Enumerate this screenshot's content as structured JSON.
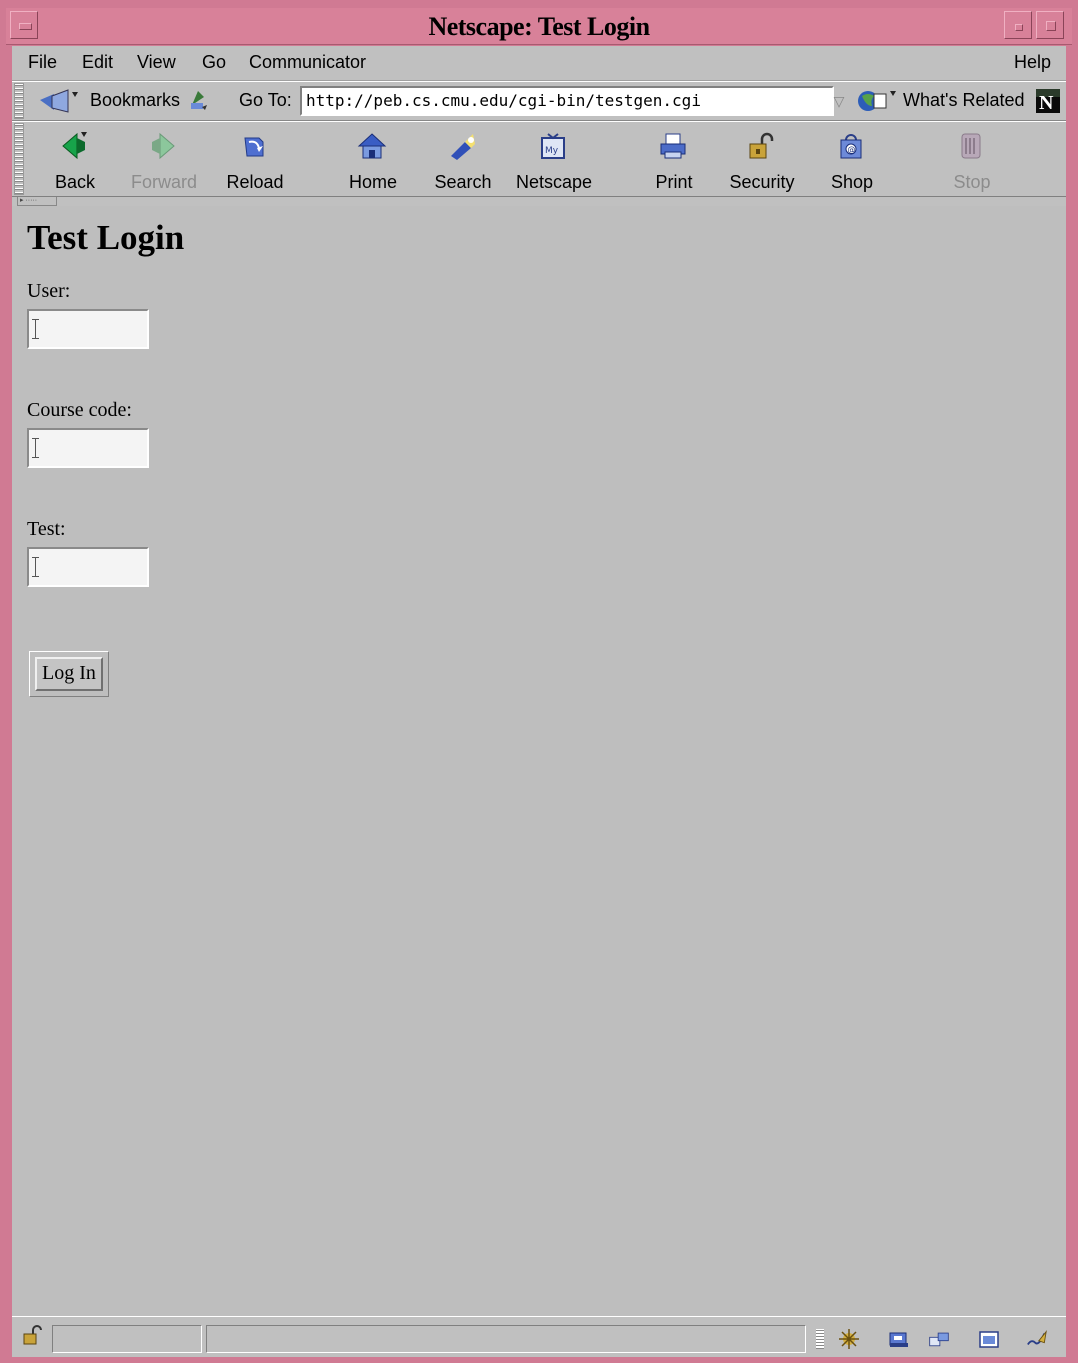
{
  "window": {
    "title": "Netscape: Test Login"
  },
  "menu": {
    "file": "File",
    "edit": "Edit",
    "view": "View",
    "go": "Go",
    "communicator": "Communicator",
    "help": "Help"
  },
  "location": {
    "bookmarks": "Bookmarks",
    "goto_label": "Go To:",
    "url": "http://peb.cs.cmu.edu/cgi-bin/testgen.cgi",
    "whats_related": "What's Related"
  },
  "nav": {
    "back": "Back",
    "forward": "Forward",
    "reload": "Reload",
    "home": "Home",
    "search": "Search",
    "netscape": "Netscape",
    "print": "Print",
    "security": "Security",
    "shop": "Shop",
    "stop": "Stop"
  },
  "page": {
    "heading": "Test Login",
    "user_label": "User:",
    "user_value": "",
    "course_label": "Course code:",
    "course_value": "",
    "test_label": "Test:",
    "test_value": "",
    "login_button": "Log In"
  },
  "status": {
    "text": ""
  },
  "colors": {
    "titlebar": "#d88199",
    "chrome": "#c0c0c0"
  }
}
